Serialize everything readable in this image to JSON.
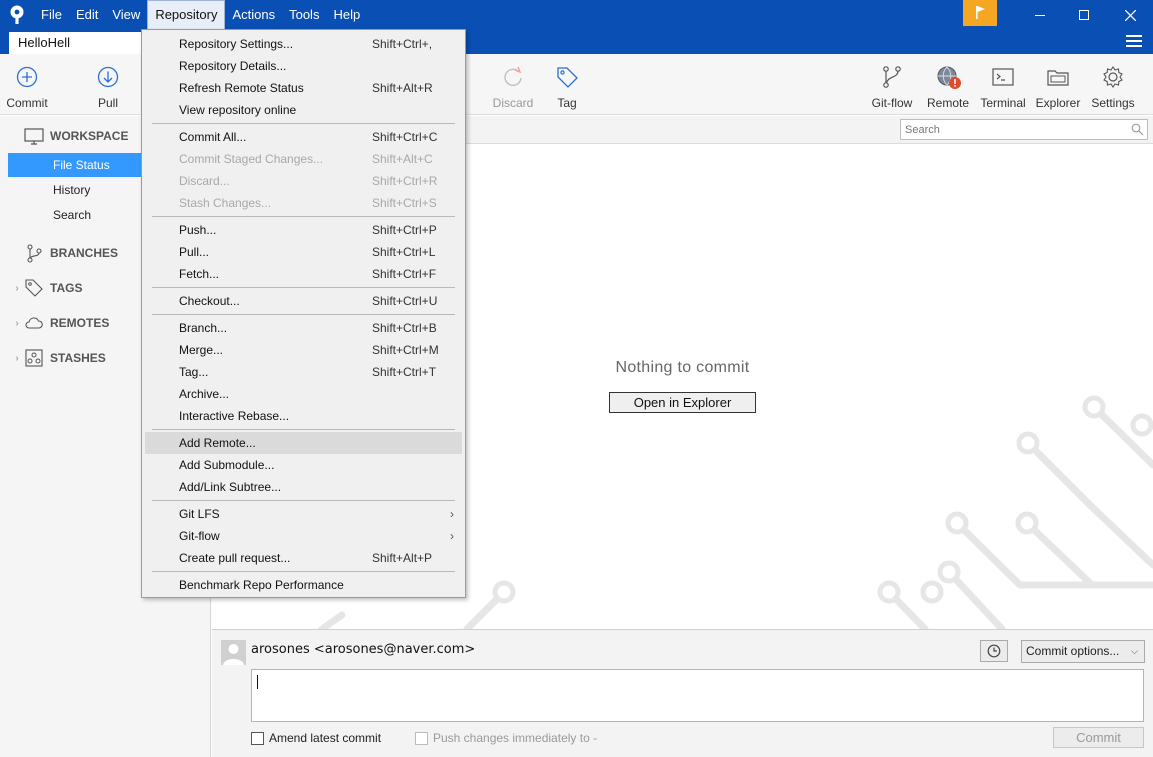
{
  "window": {
    "menu": [
      "File",
      "Edit",
      "View",
      "Repository",
      "Actions",
      "Tools",
      "Help"
    ],
    "active_menu": "Repository",
    "tab": "HelloHell"
  },
  "toolbar": {
    "commit": "Commit",
    "pull": "Pull",
    "discard": "Discard",
    "tag": "Tag",
    "gitflow": "Git-flow",
    "remote": "Remote",
    "terminal": "Terminal",
    "explorer": "Explorer",
    "settings": "Settings"
  },
  "sidebar": {
    "workspace": "WORKSPACE",
    "items": [
      "File Status",
      "History",
      "Search"
    ],
    "branches": "BRANCHES",
    "tags": "TAGS",
    "remotes": "REMOTES",
    "stashes": "STASHES"
  },
  "search": {
    "placeholder": "Search"
  },
  "main": {
    "empty_text": "Nothing to commit",
    "open_explorer": "Open in Explorer"
  },
  "commit_panel": {
    "author": "arosones <arosones@naver.com>",
    "options": "Commit options...",
    "amend": "Amend latest commit",
    "push_immediately": "Push changes immediately to -",
    "commit": "Commit"
  },
  "repo_menu": {
    "g1": [
      {
        "label": "Repository Settings...",
        "shortcut": "Shift+Ctrl+,"
      },
      {
        "label": "Repository Details...",
        "shortcut": ""
      },
      {
        "label": "Refresh Remote Status",
        "shortcut": "Shift+Alt+R"
      },
      {
        "label": "View repository online",
        "shortcut": ""
      }
    ],
    "g2": [
      {
        "label": "Commit All...",
        "shortcut": "Shift+Ctrl+C"
      },
      {
        "label": "Commit Staged Changes...",
        "shortcut": "Shift+Alt+C"
      },
      {
        "label": "Discard...",
        "shortcut": "Shift+Ctrl+R"
      },
      {
        "label": "Stash Changes...",
        "shortcut": "Shift+Ctrl+S"
      }
    ],
    "g3": [
      {
        "label": "Push...",
        "shortcut": "Shift+Ctrl+P"
      },
      {
        "label": "Pull...",
        "shortcut": "Shift+Ctrl+L"
      },
      {
        "label": "Fetch...",
        "shortcut": "Shift+Ctrl+F"
      }
    ],
    "g4": [
      {
        "label": "Checkout...",
        "shortcut": "Shift+Ctrl+U"
      }
    ],
    "g5": [
      {
        "label": "Branch...",
        "shortcut": "Shift+Ctrl+B"
      },
      {
        "label": "Merge...",
        "shortcut": "Shift+Ctrl+M"
      },
      {
        "label": "Tag...",
        "shortcut": "Shift+Ctrl+T"
      },
      {
        "label": "Archive...",
        "shortcut": ""
      },
      {
        "label": "Interactive Rebase...",
        "shortcut": ""
      }
    ],
    "g6": [
      {
        "label": "Add Remote...",
        "shortcut": ""
      },
      {
        "label": "Add Submodule...",
        "shortcut": ""
      },
      {
        "label": "Add/Link Subtree...",
        "shortcut": ""
      }
    ],
    "g7": [
      {
        "label": "Git LFS",
        "shortcut": ""
      },
      {
        "label": "Git-flow",
        "shortcut": ""
      },
      {
        "label": "Create pull request...",
        "shortcut": "Shift+Alt+P"
      }
    ],
    "g8": [
      {
        "label": "Benchmark Repo Performance",
        "shortcut": ""
      }
    ]
  },
  "colors": {
    "titlebar": "#0a4fb3",
    "selection": "#3399ff",
    "flag": "#f5a623",
    "badge": "#e04b2c"
  }
}
